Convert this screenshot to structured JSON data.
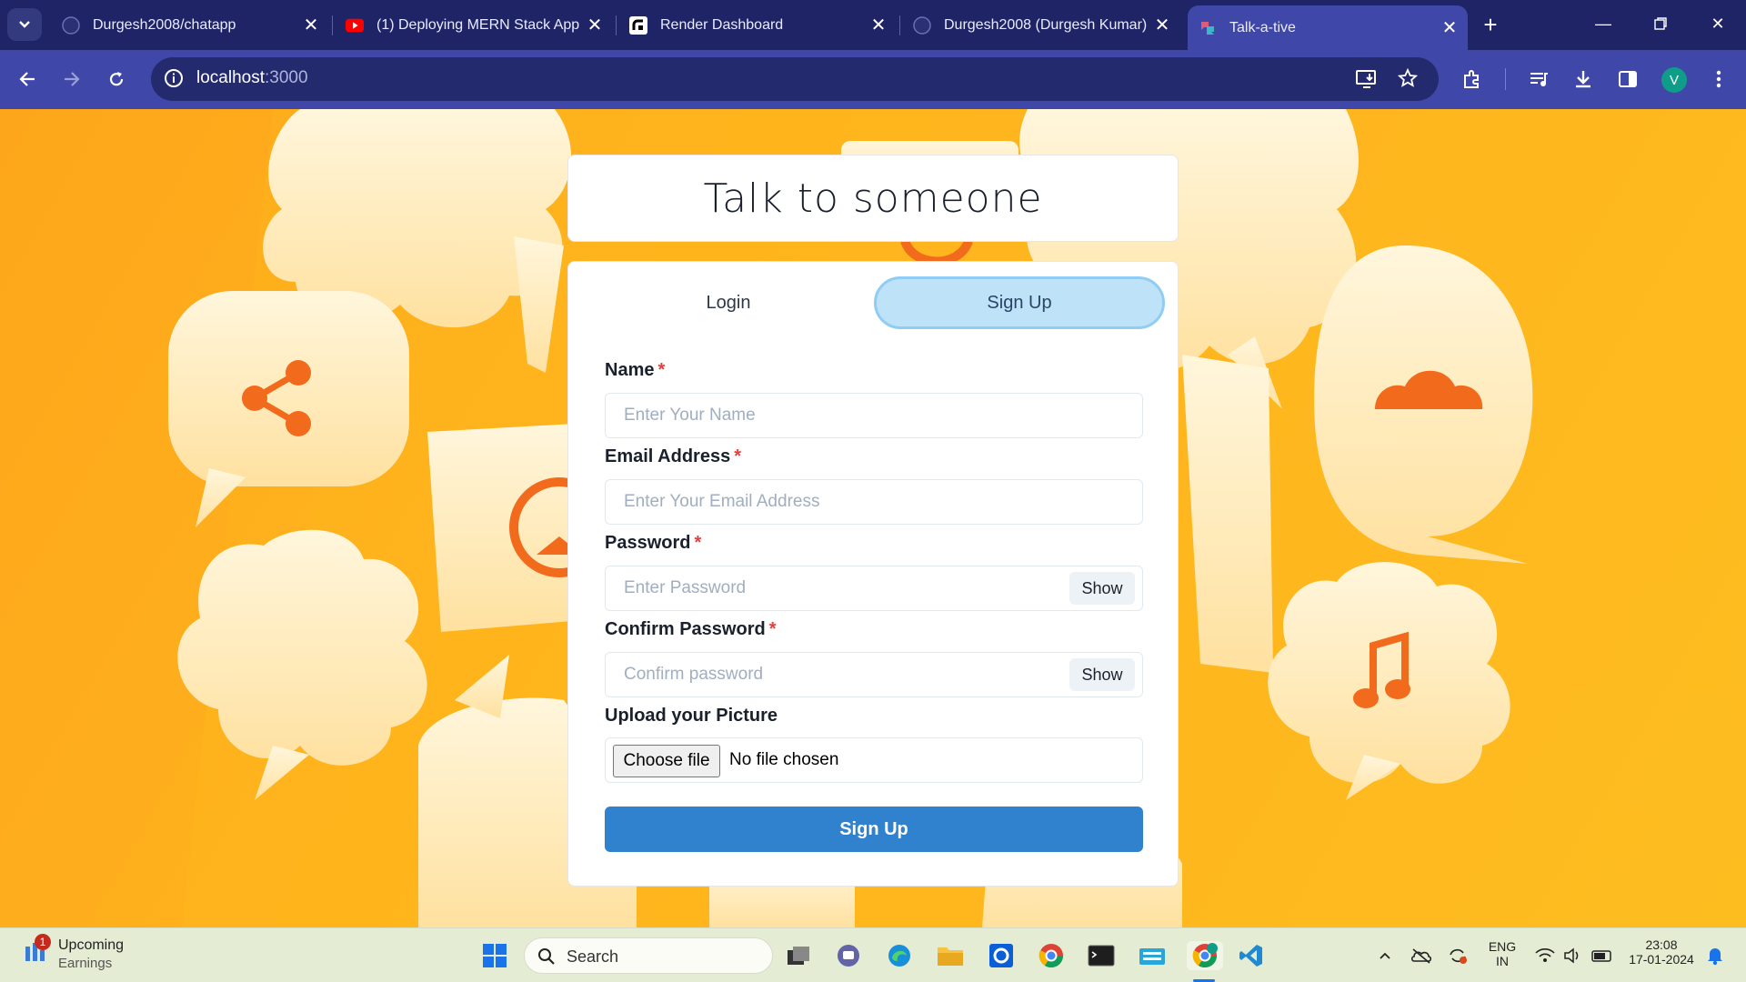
{
  "browser": {
    "tabs": [
      {
        "title": "Durgesh2008/chatapp",
        "icon": "github-icon"
      },
      {
        "title": "(1) Deploying MERN Stack App t",
        "icon": "youtube-icon"
      },
      {
        "title": "Render Dashboard",
        "icon": "render-icon"
      },
      {
        "title": "Durgesh2008 (Durgesh Kumar)",
        "icon": "github-icon"
      },
      {
        "title": "Talk-a-tive",
        "icon": "chat-app-icon",
        "active": true
      }
    ],
    "url_host": "localhost",
    "url_port": ":3000",
    "profile_initial": "V"
  },
  "app": {
    "title": "Talk to someone",
    "tabs": {
      "login": "Login",
      "signup": "Sign Up"
    },
    "form": {
      "name_label": "Name",
      "name_placeholder": "Enter Your Name",
      "email_label": "Email Address",
      "email_placeholder": "Enter Your Email Address",
      "password_label": "Password",
      "password_placeholder": "Enter Password",
      "confirm_label": "Confirm Password",
      "confirm_placeholder": "Confirm password",
      "show_label": "Show",
      "picture_label": "Upload your Picture",
      "choose_file": "Choose file",
      "no_file": "No file chosen",
      "required_mark": "*",
      "submit_label": "Sign Up"
    },
    "colors": {
      "primary": "#3182ce",
      "active_tab": "#bee3f8",
      "background": "#ffb21c"
    }
  },
  "taskbar": {
    "weather_title": "Upcoming",
    "weather_sub": "Earnings",
    "weather_badge": "1",
    "search_label": "Search",
    "lang_top": "ENG",
    "lang_bottom": "IN",
    "time": "23:08",
    "date": "17-01-2024"
  }
}
